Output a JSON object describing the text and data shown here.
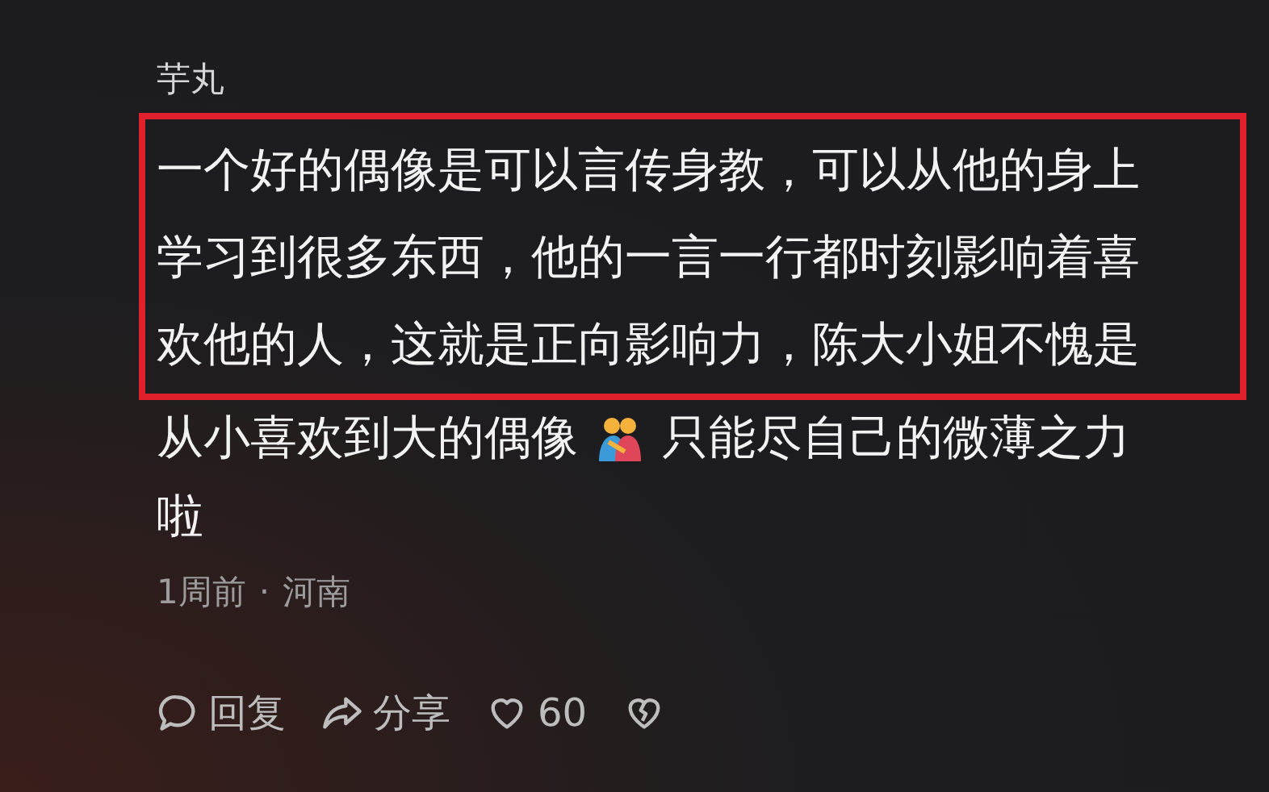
{
  "comment": {
    "author": "芋丸",
    "highlighted_lines": [
      "一个好的偶像是可以言传身教，可以从他的身上",
      "学习到很多东西，他的一言一行都时刻影响着喜",
      "欢他的人，这就是正向影响力，陈大小姐不愧是"
    ],
    "rest_lines": [
      {
        "kind": "text_emoji_text",
        "text": "从小喜欢到大的偶像",
        "text_after": "只能尽自己的微薄之力"
      },
      {
        "kind": "text",
        "text": "啦"
      }
    ],
    "meta": {
      "time": "1周前",
      "separator": "·",
      "region": "河南"
    },
    "actions": [
      {
        "kind": "reply",
        "label": "回复"
      },
      {
        "kind": "share",
        "label": "分享"
      },
      {
        "kind": "like",
        "label": "60"
      },
      {
        "kind": "dislike"
      }
    ]
  }
}
